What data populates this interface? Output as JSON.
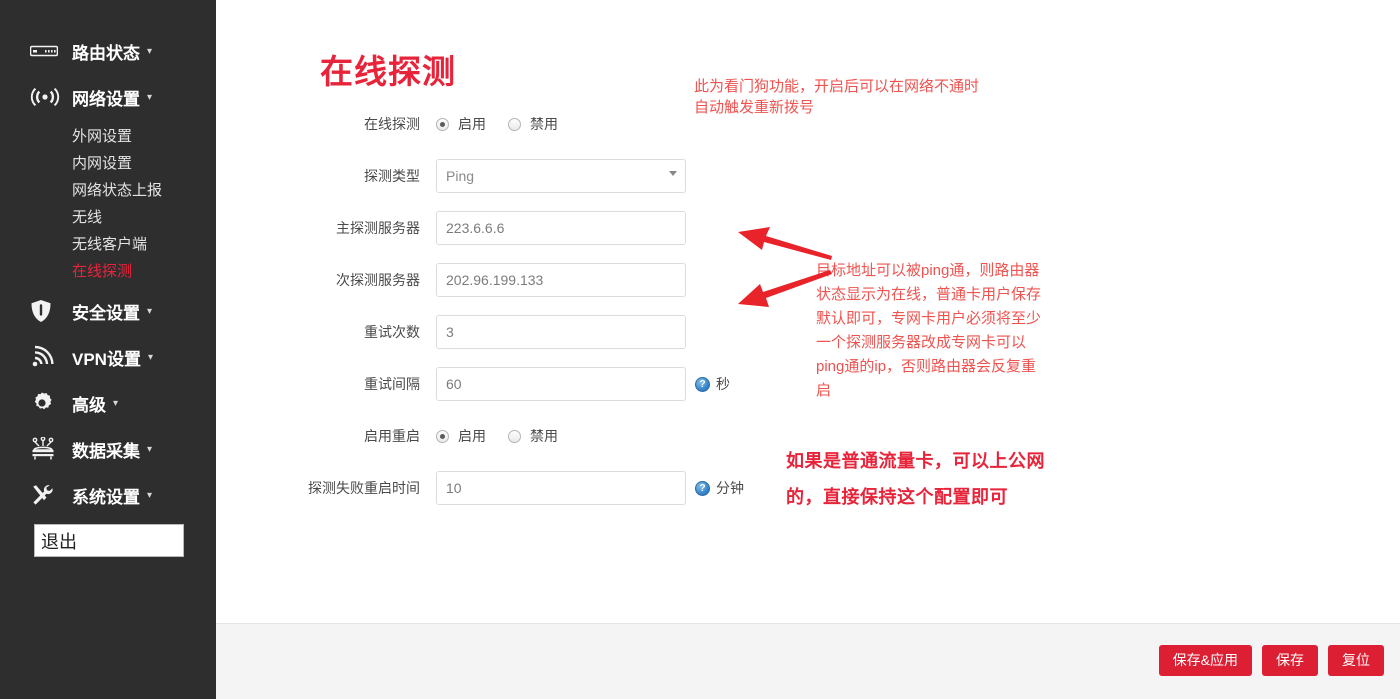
{
  "sidebar": {
    "nav": [
      {
        "icon": "router-icon",
        "label": "路由状态",
        "caret": "▾"
      },
      {
        "icon": "wifi-signal-icon",
        "label": "网络设置",
        "caret": "▾"
      }
    ],
    "subnav": [
      {
        "label": "外网设置",
        "active": false
      },
      {
        "label": "内网设置",
        "active": false
      },
      {
        "label": "网络状态上报",
        "active": false
      },
      {
        "label": "无线",
        "active": false
      },
      {
        "label": "无线客户端",
        "active": false
      },
      {
        "label": "在线探测",
        "active": true
      }
    ],
    "nav2": [
      {
        "icon": "shield-icon",
        "label": "安全设置",
        "caret": "▾"
      },
      {
        "icon": "vpn-waves-icon",
        "label": "VPN设置",
        "caret": "▾"
      },
      {
        "icon": "gear-icon",
        "label": "高级",
        "caret": "▾"
      },
      {
        "icon": "data-collect-icon",
        "label": "数据采集",
        "caret": "▾"
      },
      {
        "icon": "tools-icon",
        "label": "系统设置",
        "caret": "▾"
      }
    ],
    "logout_label": "退出"
  },
  "main": {
    "title": "在线探测",
    "rows": [
      {
        "label": "在线探测",
        "type": "radio",
        "options": [
          {
            "label": "启用",
            "selected": true
          },
          {
            "label": "禁用",
            "selected": false
          }
        ]
      },
      {
        "label": "探测类型",
        "type": "select",
        "value": "Ping"
      },
      {
        "label": "主探测服务器",
        "type": "text",
        "value": "223.6.6.6"
      },
      {
        "label": "次探测服务器",
        "type": "text",
        "value": "202.96.199.133"
      },
      {
        "label": "重试次数",
        "type": "text",
        "value": "3"
      },
      {
        "label": "重试间隔",
        "type": "text",
        "value": "60",
        "help": "?",
        "unit": "秒"
      },
      {
        "label": "启用重启",
        "type": "radio",
        "options": [
          {
            "label": "启用",
            "selected": true
          },
          {
            "label": "禁用",
            "selected": false
          }
        ]
      },
      {
        "label": "探测失败重启时间",
        "type": "text",
        "value": "10",
        "help": "?",
        "unit": "分钟"
      }
    ]
  },
  "annotations": {
    "watchdog": "此为看门狗功能，开启后可以在网络不通时\n自动触发重新拨号",
    "ping": "目标地址可以被ping通，则路由器\n状态显示为在线，普通卡用户保存\n默认即可，专网卡用户必须将至少\n一个探测服务器改成专网卡可以\nping通的ip，否则路由器会反复重\n启",
    "bold": "如果是普通流量卡，可以上公网\n的，直接保持这个配置即可"
  },
  "footer": {
    "buttons": [
      {
        "label": "保存&应用"
      },
      {
        "label": "保存"
      },
      {
        "label": "复位"
      }
    ]
  },
  "colors": {
    "sidebar_bg": "#2e2e2e",
    "accent_red": "#e8243b",
    "button_red": "#dd1f33",
    "annotation_red": "#ef5350",
    "footer_bg": "#f4f4f4"
  }
}
